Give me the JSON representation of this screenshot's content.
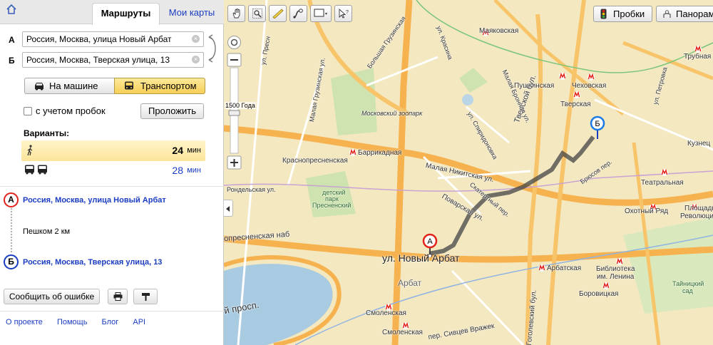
{
  "panel": {
    "tabs": {
      "routes": "Маршруты",
      "my_maps": "Мои карты"
    },
    "from": {
      "letter": "А",
      "value": "Россия, Москва, улица Новый Арбат"
    },
    "to": {
      "letter": "Б",
      "value": "Россия, Москва, Тверская улица, 13"
    },
    "modes": {
      "car": "На машине",
      "transit": "Транспортом"
    },
    "traffic_check": "с учетом пробок",
    "build_button": "Проложить",
    "variants_label": "Варианты:",
    "variants": [
      {
        "type": "walk",
        "time": "24",
        "unit": "мин"
      },
      {
        "type": "bus",
        "time": "28",
        "unit": "мин"
      }
    ],
    "steps": {
      "start_letter": "А",
      "start": "Россия, Москва, улица Новый Арбат",
      "walk": "Пешком 2 км",
      "end_letter": "Б",
      "end": "Россия, Москва, Тверская улица, 13"
    },
    "report_button": "Сообщить об ошибке",
    "footer_links": [
      "О проекте",
      "Помощь",
      "Блог",
      "API"
    ]
  },
  "map": {
    "traffic_button": "Пробки",
    "panorama_button": "Панорамы",
    "zoom_label": "1500 Года",
    "labels": {
      "mayakovskaya": "Маяковская",
      "trubnaya": "Трубная",
      "pushkinskaya": "Пушкинская",
      "chekhovskaya": "Чеховская",
      "tverskaya": "Тверская",
      "barrikadnaya": "Баррикадная",
      "krasnopresnenskaya": "Краснопресненская",
      "teatralnaya": "Театральная",
      "okhotny_ryad": "Охотный Ряд",
      "ploshchad_1": "Площадь",
      "ploshchad_2": "Революции",
      "arbatskaya": "Арбатская",
      "biblioteka_1": "Библиотека",
      "biblioteka_2": "им. Ленина",
      "borovitskaya": "Боровицкая",
      "smolenskaya_1": "Смоленская",
      "smolenskaya_2": "Смоленская",
      "kuznetsky": "Кузнец",
      "zoo": "Московский зоопарк",
      "park_1": "детский",
      "park_2": "парк",
      "park_3": "Пресненский",
      "tainitsky_1": "Тайницкий",
      "tainitsky_2": "сад",
      "street_novy_arbat": "ул. Новый Арбат",
      "street_arbat": "Арбат",
      "street_tverskoy": "Тверской бул.",
      "street_presnenskaya": "опресненская наб",
      "street_randelskaya": "Рондельская ул.",
      "street_presnya": "ул. Пресн",
      "street_gruzinskaya": "Малая Грузинская ул.",
      "street_b_gruzinskaya": "Большая Грузинская",
      "street_nikitskaya": "Малая Никитская ул.",
      "street_skaterny": "Скатертный пер.",
      "street_povarskaya": "Поварская ул.",
      "street_spiridonovka": "ул. Спиридоновка",
      "street_bronnaya": "Малая Бронная ул.",
      "street_petrovka": "ул. Петровка",
      "street_bryusov": "Брюсов пер.",
      "street_gogolevsky": "Гоголевский бул.",
      "street_prosp": "й просп.",
      "street_sivtsev": "пер. Сивцев Вражек",
      "street_krasina": "ул. Красина"
    }
  }
}
